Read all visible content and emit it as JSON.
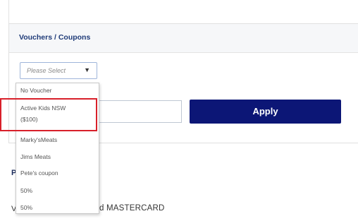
{
  "vouchers": {
    "title": "Vouchers / Coupons",
    "select_placeholder": "Please Select",
    "select_arrow_icon": "caret-down-icon",
    "code_input_value": "",
    "apply_label": "Apply",
    "options": [
      {
        "label": "No Voucher"
      },
      {
        "label": "Active Kids NSW ($100)"
      },
      {
        "label": "Marky'sMeats"
      },
      {
        "label": "Jims Meats"
      },
      {
        "label": "Pete's coupon"
      },
      {
        "label": "50%"
      },
      {
        "label": "50%"
      }
    ]
  },
  "background": {
    "heading_fragment": "P",
    "payment_fragment_v": "V",
    "payment_text_fragment": "d MASTERCARD"
  },
  "colors": {
    "apply_button": "#0c1676",
    "title_text": "#1f3b78",
    "highlight_border": "#d8202a"
  }
}
